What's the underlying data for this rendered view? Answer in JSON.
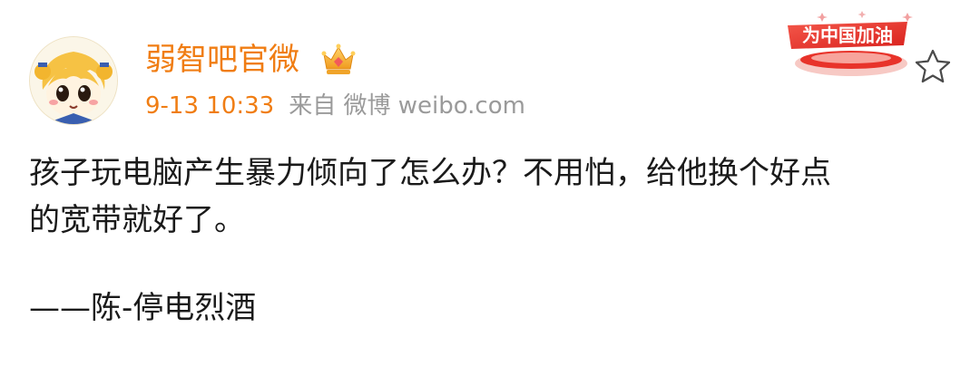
{
  "post": {
    "author": {
      "name": "弱智吧官微",
      "badge_icon": "crown-vip-icon"
    },
    "time": "9-13 10:33",
    "source": "来自 微博 weibo.com",
    "promo_text": "为中国加油",
    "star_icon": "star-outline-icon",
    "content_line1": "孩子玩电脑产生暴力倾向了怎么办？不用怕，给他换个好点",
    "content_line2": "的宽带就好了。",
    "signature": "——陈-停电烈酒"
  },
  "colors": {
    "username": "#f07d13",
    "time": "#f07d13",
    "meta": "#9a9a9a",
    "text": "#1a1a1a",
    "promo_red": "#e8332a"
  }
}
